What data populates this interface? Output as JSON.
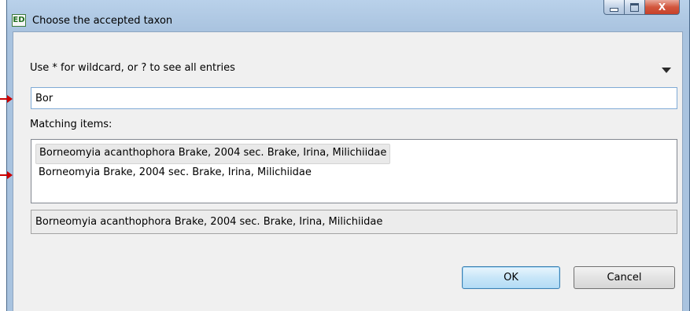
{
  "window": {
    "title": "Choose the accepted taxon",
    "app_icon_text": "ED",
    "close_glyph": "X"
  },
  "dialog": {
    "hint": "Use * for wildcard, or ? to see all entries",
    "search_value": "Bor",
    "matching_label": "Matching items:",
    "items": [
      {
        "label": "Borneomyia acanthophora Brake, 2004 sec. Brake, Irina, Milichiidae",
        "selected": true
      },
      {
        "label": "Borneomyia Brake, 2004 sec. Brake, Irina, Milichiidae",
        "selected": false
      }
    ],
    "status_text": "Borneomyia acanthophora Brake, 2004 sec. Brake, Irina, Milichiidae",
    "ok_label": "OK",
    "cancel_label": "Cancel"
  },
  "colors": {
    "annotation_arrow": "#cc0000",
    "focus_border": "#7faad6"
  }
}
